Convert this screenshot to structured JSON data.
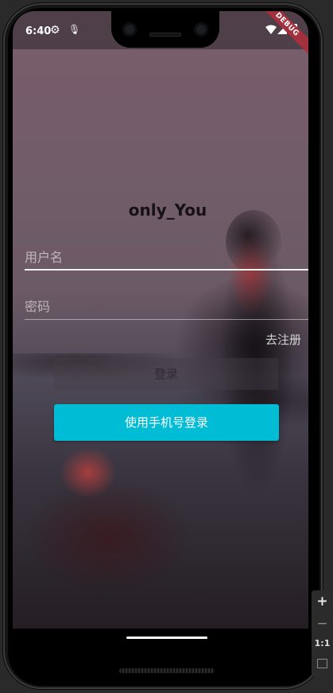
{
  "status_bar": {
    "time": "6:40",
    "icons": [
      "gear-icon",
      "mic-icon",
      "wifi-icon",
      "signal-icon",
      "battery-icon"
    ]
  },
  "debug_banner": "DEBUG",
  "app": {
    "title": "only_You",
    "username_placeholder": "用户名",
    "password_placeholder": "密码",
    "register_link": "去注册",
    "login_button": "登录",
    "phone_login_button": "使用手机号登录"
  },
  "colors": {
    "accent": "#00bcd4",
    "debug_banner": "#a3313d"
  },
  "zoom_controls": {
    "zoom_in": "+",
    "zoom_out": "−",
    "ratio": "1:1",
    "icons": [
      "zoom-in-icon",
      "zoom-out-icon",
      "fit-screen-icon"
    ]
  }
}
